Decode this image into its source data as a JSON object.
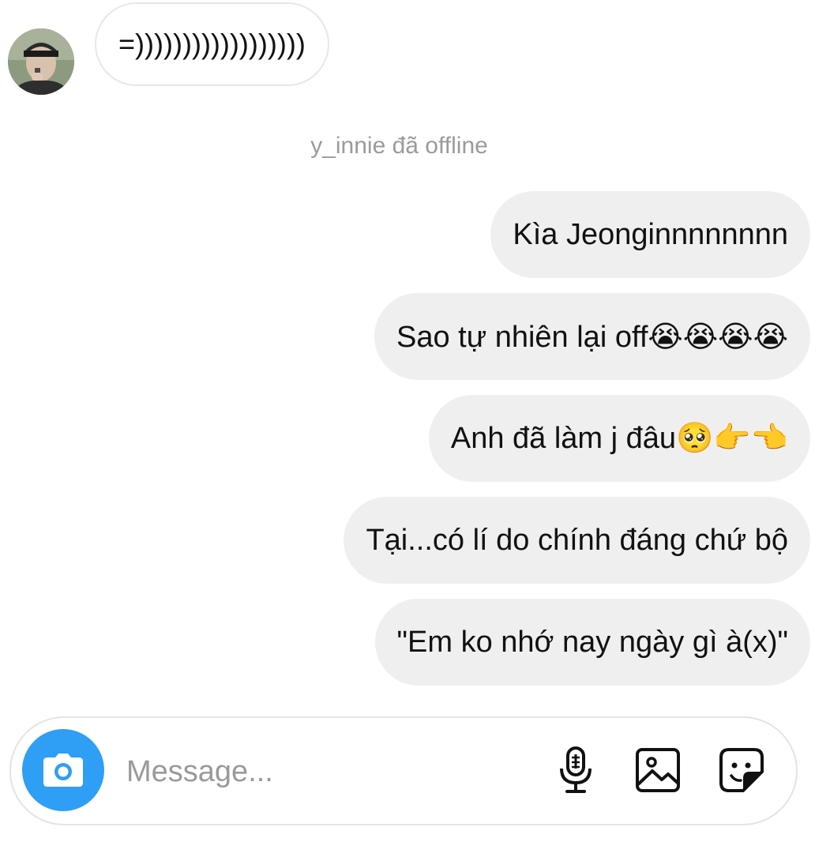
{
  "thread": {
    "incoming_message": "=))))))))))))))))))",
    "status_text": "y_innie đã offline",
    "outgoing_messages": [
      "Kìa Jeonginnnnnnnn",
      "Sao tự nhiên lại off😭😭😭😭",
      "Anh đã làm j đâu🥺👉👈",
      "Tại...có lí do chính đáng chứ bộ",
      "\"Em ko nhớ nay ngày gì à(x)\""
    ]
  },
  "composer": {
    "placeholder": "Message..."
  },
  "icons": {
    "camera": "camera-icon",
    "microphone": "microphone-icon",
    "gallery": "gallery-icon",
    "sticker": "sticker-icon"
  },
  "colors": {
    "accent": "#2f9ef5",
    "outgoing_bubble": "#efefef",
    "status_text": "#9b9b9b"
  }
}
